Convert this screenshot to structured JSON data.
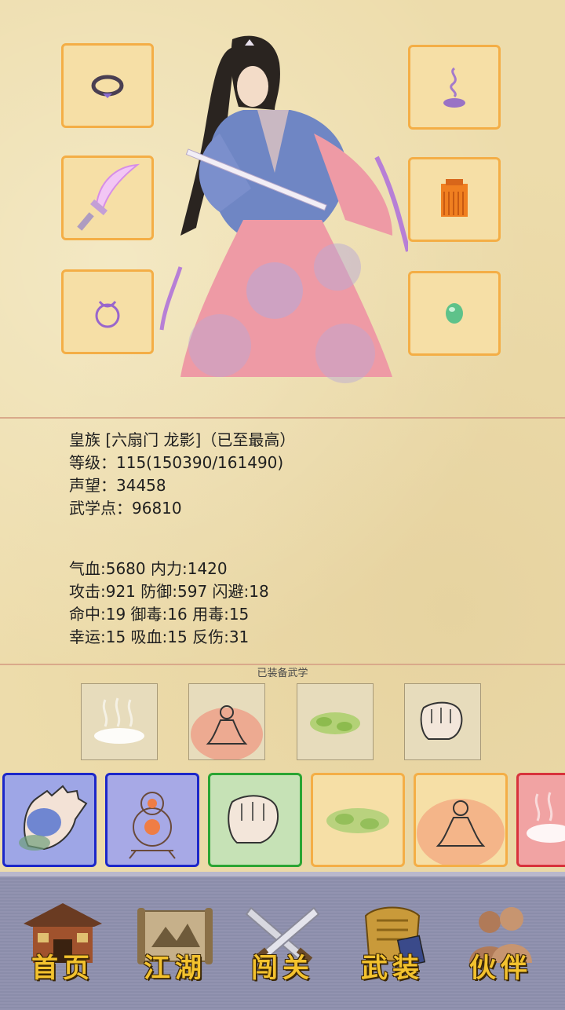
{
  "character": {
    "title_line": "皇族 [六扇门 龙影]（已至最高）",
    "level_line": "等级：115(150390/161490)",
    "fame_line": "声望：34458",
    "points_line": "武学点：96810"
  },
  "stats": {
    "line1": "气血:5680  内力:1420",
    "line2": "攻击:921  防御:597  闪避:18",
    "line3": "命中:19  御毒:16  用毒:15",
    "line4": "幸运:15  吸血:15  反伤:31"
  },
  "equipment_slots": [
    {
      "icon": "ring-icon"
    },
    {
      "icon": "incense-icon"
    },
    {
      "icon": "sword-icon"
    },
    {
      "icon": "armor-icon"
    },
    {
      "icon": "bracelet-icon"
    },
    {
      "icon": "jade-icon"
    }
  ],
  "equipped_martial": {
    "label": "已装备武学",
    "skills": [
      "mist-icon",
      "meditation-icon",
      "moss-icon",
      "fist-icon"
    ]
  },
  "skill_bar": [
    {
      "icon": "palm-icon",
      "border": "#1c27c9",
      "fill": "#9ea6e6"
    },
    {
      "icon": "gourd-icon",
      "border": "#1c27c9",
      "fill": "#a7a9e6"
    },
    {
      "icon": "fist-icon",
      "border": "#2aa533",
      "fill": "#c6e2b6"
    },
    {
      "icon": "moss-icon",
      "border": "#f4ae46",
      "fill": "#f6dfa6"
    },
    {
      "icon": "meditation-icon",
      "border": "#f4ae46",
      "fill": "#f6dfa6"
    },
    {
      "icon": "mist-icon",
      "border": "#d8323c",
      "fill": "#f1a3a3"
    }
  ],
  "nav": {
    "home": "首页",
    "jianghu": "江湖",
    "challenge": "闯关",
    "gear": "武装",
    "partner": "伙伴"
  },
  "colors": {
    "parchment": "#eddcab",
    "slot_border": "#f4ae46",
    "nav_bg": "#8e90ad",
    "nav_text": "#f3c22e"
  }
}
